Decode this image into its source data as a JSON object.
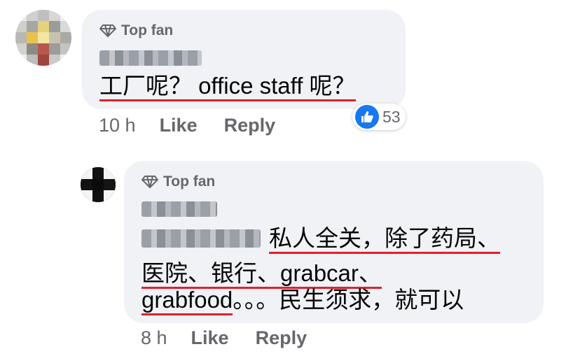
{
  "comments": [
    {
      "badge": "Top fan",
      "text": "工厂呢？ office staff 呢？",
      "reaction_count": "53",
      "time": "10 h",
      "like_label": "Like",
      "reply_label": "Reply"
    },
    {
      "badge": "Top fan",
      "text_line1": "私人全关，除了药局、",
      "text_line2": "医院、银行、grabcar、",
      "text_line3a": "grabfood",
      "text_line3b": "。。。民生须求，就可以",
      "time": "8 h",
      "like_label": "Like",
      "reply_label": "Reply"
    }
  ],
  "colors": {
    "bubble": "#f0f2f5",
    "meta_text": "#65676b",
    "underline": "#e0202e",
    "like_blue": "#1877f2"
  },
  "icons": [
    "diamond-icon",
    "thumbs-up-icon"
  ]
}
